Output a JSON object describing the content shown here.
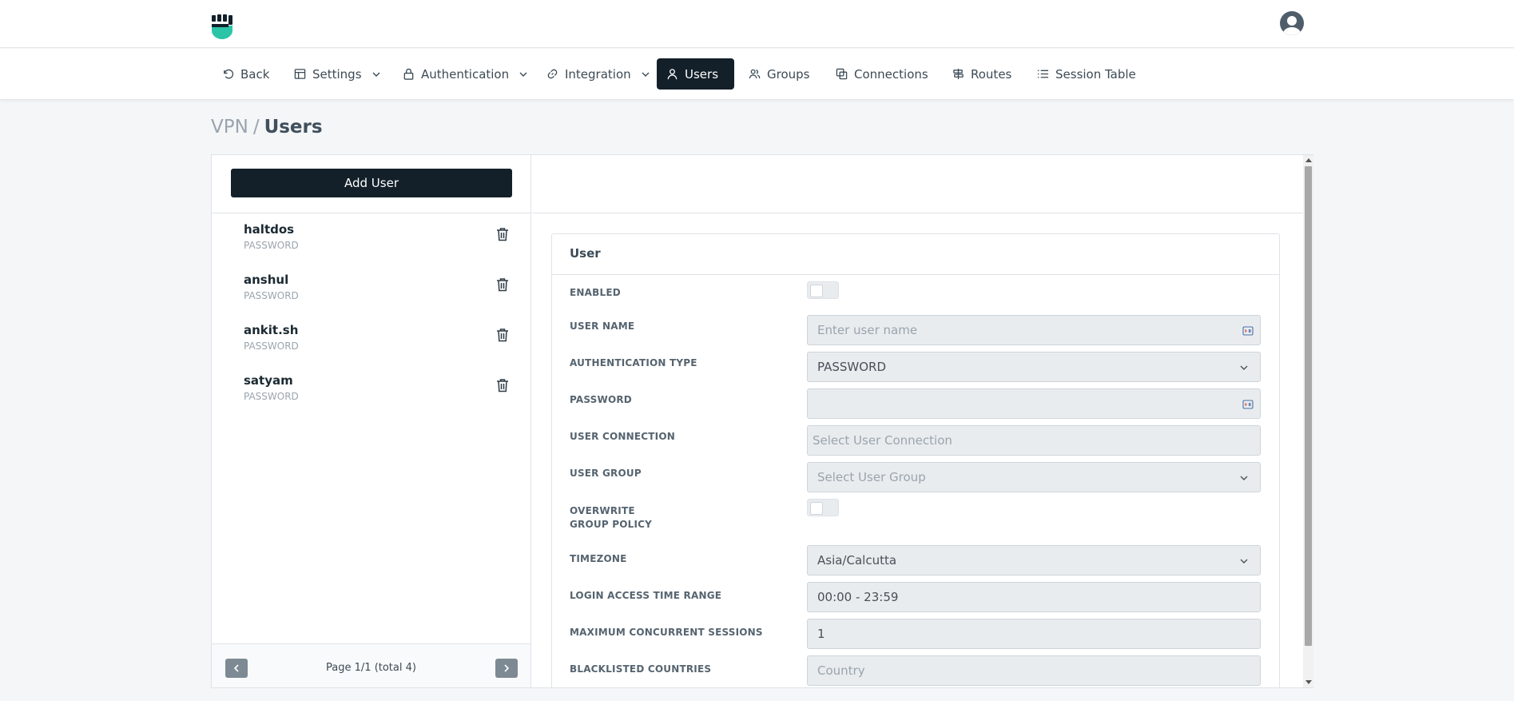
{
  "colors": {
    "accent": "#13202a",
    "brand_teal": "#2bc4a6",
    "muted": "#9aa4ad"
  },
  "nav": {
    "items": [
      {
        "label": "Back",
        "icon": "undo-icon"
      },
      {
        "label": "Settings",
        "icon": "layout-icon",
        "dropdown": true
      },
      {
        "label": "Authentication",
        "icon": "lock-icon",
        "dropdown": true
      },
      {
        "label": "Integration",
        "icon": "link-icon",
        "dropdown": true
      },
      {
        "label": "Users",
        "icon": "user-icon",
        "active": true
      },
      {
        "label": "Groups",
        "icon": "users-icon"
      },
      {
        "label": "Connections",
        "icon": "copy-icon"
      },
      {
        "label": "Routes",
        "icon": "signpost-icon"
      },
      {
        "label": "Session Table",
        "icon": "list-icon"
      }
    ]
  },
  "breadcrumb": {
    "root": "VPN",
    "separator": "/",
    "current": "Users"
  },
  "users_panel": {
    "add_label": "Add User",
    "users": [
      {
        "name": "haltdos",
        "type": "PASSWORD"
      },
      {
        "name": "anshul",
        "type": "PASSWORD"
      },
      {
        "name": "ankit.sh",
        "type": "PASSWORD"
      },
      {
        "name": "satyam",
        "type": "PASSWORD"
      }
    ],
    "pager": {
      "text": "Page 1/1 (total 4)"
    }
  },
  "form": {
    "title": "User",
    "enabled": {
      "label": "ENABLED",
      "value": false
    },
    "user_name": {
      "label": "USER NAME",
      "placeholder": "Enter user name",
      "value": ""
    },
    "auth_type": {
      "label": "AUTHENTICATION TYPE",
      "value": "PASSWORD"
    },
    "password": {
      "label": "PASSWORD",
      "value": ""
    },
    "user_connection": {
      "label": "USER CONNECTION",
      "placeholder": "Select User Connection"
    },
    "user_group": {
      "label": "USER GROUP",
      "placeholder": "Select User Group"
    },
    "overwrite": {
      "label_line1": "OVERWRITE",
      "label_line2": "GROUP POLICY",
      "value": false
    },
    "timezone": {
      "label": "TIMEZONE",
      "value": "Asia/Calcutta"
    },
    "login_time": {
      "label": "LOGIN ACCESS TIME RANGE",
      "value": "00:00 - 23:59"
    },
    "max_sessions": {
      "label": "MAXIMUM CONCURRENT SESSIONS",
      "value": "1"
    },
    "blacklisted": {
      "label": "BLACKLISTED COUNTRIES",
      "placeholder": "Country"
    }
  }
}
